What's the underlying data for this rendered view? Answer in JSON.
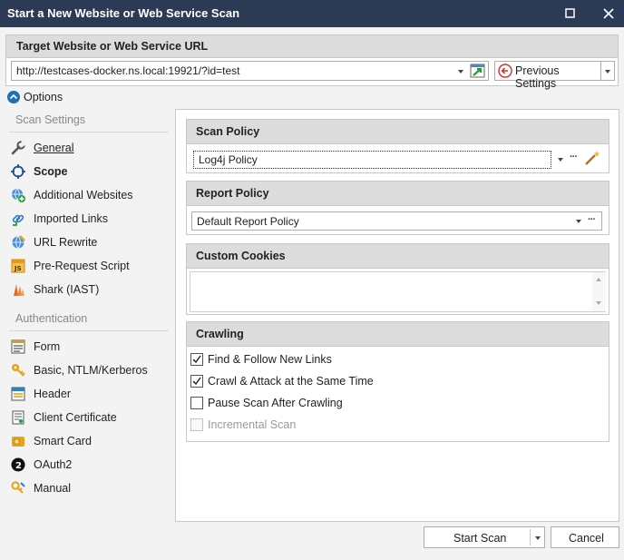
{
  "window": {
    "title": "Start a New Website or Web Service Scan"
  },
  "target": {
    "header": "Target Website or Web Service URL",
    "url_value": "http://testcases-docker.ns.local:19921/?id=test",
    "previous_settings_label": "Previous Settings"
  },
  "options": {
    "label": "Options"
  },
  "sidebar": {
    "scan_settings_label": "Scan Settings",
    "scan_items": [
      {
        "label": "General",
        "icon": "wrench-icon",
        "style": "underlined"
      },
      {
        "label": "Scope",
        "icon": "target-icon",
        "style": "bold"
      },
      {
        "label": "Additional Websites",
        "icon": "globe-plus-icon"
      },
      {
        "label": "Imported Links",
        "icon": "link-import-icon"
      },
      {
        "label": "URL Rewrite",
        "icon": "url-rewrite-icon"
      },
      {
        "label": "Pre-Request Script",
        "icon": "js-script-icon"
      },
      {
        "label": "Shark (IAST)",
        "icon": "shark-icon"
      }
    ],
    "authentication_label": "Authentication",
    "auth_items": [
      {
        "label": "Form",
        "icon": "form-icon"
      },
      {
        "label": "Basic, NTLM/Kerberos",
        "icon": "key-icon"
      },
      {
        "label": "Header",
        "icon": "header-icon"
      },
      {
        "label": "Client Certificate",
        "icon": "certificate-icon"
      },
      {
        "label": "Smart Card",
        "icon": "smart-card-icon"
      },
      {
        "label": "OAuth2",
        "icon": "oauth2-icon"
      },
      {
        "label": "Manual",
        "icon": "manual-key-icon"
      }
    ]
  },
  "scan_policy": {
    "header": "Scan Policy",
    "value": "Log4j Policy"
  },
  "report_policy": {
    "header": "Report Policy",
    "value": "Default Report Policy"
  },
  "custom_cookies": {
    "header": "Custom Cookies",
    "value": ""
  },
  "crawling": {
    "header": "Crawling",
    "options": [
      {
        "label": "Find & Follow New Links",
        "checked": true,
        "enabled": true
      },
      {
        "label": "Crawl & Attack at the Same Time",
        "checked": true,
        "enabled": true
      },
      {
        "label": "Pause Scan After Crawling",
        "checked": false,
        "enabled": true
      },
      {
        "label": "Incremental Scan",
        "checked": false,
        "enabled": false
      }
    ]
  },
  "footer": {
    "start_label": "Start Scan",
    "cancel_label": "Cancel"
  },
  "colors": {
    "titlebar": "#2b3a55",
    "accent": "#1f6fb2",
    "panel_header": "#dcdcdc"
  }
}
